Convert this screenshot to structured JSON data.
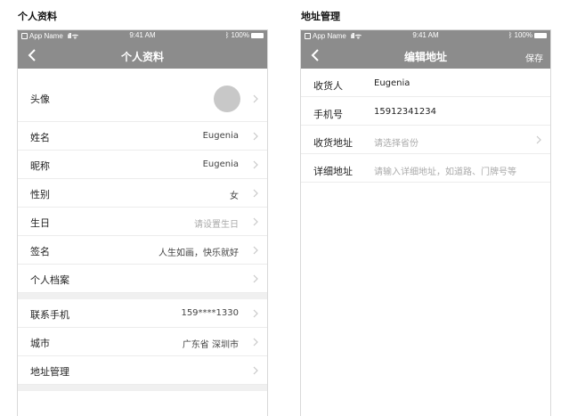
{
  "left_section": {
    "title": "个人资料",
    "status_bar": {
      "carrier": "App Name",
      "time": "9:41 AM",
      "battery": "100%"
    },
    "nav": {
      "title": "个人资料"
    },
    "avatar_row": {
      "label": "头像"
    },
    "group1": [
      {
        "label": "姓名",
        "value": "Eugenia"
      },
      {
        "label": "昵称",
        "value": "Eugenia"
      },
      {
        "label": "性别",
        "value": "女"
      },
      {
        "label": "生日",
        "value": "请设置生日"
      },
      {
        "label": "签名",
        "value": "人生如画，快乐就好"
      },
      {
        "label": "个人档案",
        "value": ""
      }
    ],
    "group2": [
      {
        "label": "联系手机",
        "value": "159****1330"
      },
      {
        "label": "城市",
        "value": "广东省  深圳市"
      },
      {
        "label": "地址管理",
        "value": ""
      }
    ]
  },
  "right_section": {
    "title": "地址管理",
    "status_bar": {
      "carrier": "App Name",
      "time": "9:41 AM",
      "battery": "100%"
    },
    "nav": {
      "title": "编辑地址",
      "action": "保存"
    },
    "fields": [
      {
        "label": "收货人",
        "value": "Eugenia"
      },
      {
        "label": "手机号",
        "value": "15912341234"
      },
      {
        "label": "收货地址",
        "value": "请选择省份"
      },
      {
        "label": "详细地址",
        "value": "请输入详细地址，如道路、门牌号等"
      }
    ]
  }
}
